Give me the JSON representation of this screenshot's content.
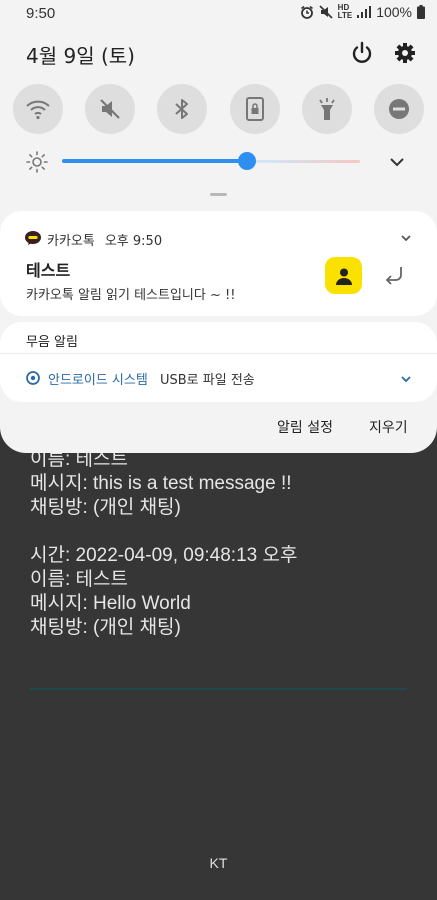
{
  "status_bar": {
    "time": "9:50",
    "network_top": "HD",
    "network_bottom": "LTE",
    "battery": "100%"
  },
  "header": {
    "date": "4월 9일 (토)"
  },
  "quick_settings": {
    "tiles": [
      "wifi-icon",
      "mute-icon",
      "bluetooth-icon",
      "portrait-lock-icon",
      "flashlight-icon",
      "do-not-disturb-icon"
    ]
  },
  "brightness": {
    "level": 0.62
  },
  "notification": {
    "app_name": "카카오톡",
    "time": "오후 9:50",
    "title": "테스트",
    "body": "카카오톡 알림 읽기 테스트입니다 ~ !!"
  },
  "silent": {
    "section_title": "무음 알림",
    "app_name": "안드로이드 시스템",
    "message": "USB로 파일 전송"
  },
  "actions": {
    "settings_label": "알림 설정",
    "clear_label": "지우기"
  },
  "app_log": {
    "lines": [
      "이름: 테스트",
      "메시지: this is a test message !!",
      "채팅방: (개인 채팅)",
      "",
      "시간: 2022-04-09, 09:48:13 오후",
      "이름: 테스트",
      "메시지: Hello World",
      "채팅방: (개인 채팅)"
    ]
  },
  "footer": {
    "carrier": "KT"
  },
  "colors": {
    "accent": "#2d8ff0",
    "kakao_yellow": "#fae100"
  }
}
